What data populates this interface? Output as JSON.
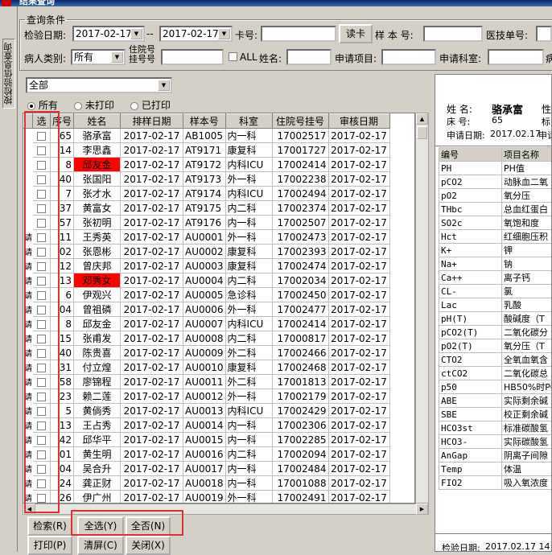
{
  "window": {
    "title": "结果查询"
  },
  "side_tab": {
    "label": "按检验信息查询"
  },
  "query": {
    "legend": "查询条件",
    "date_label": "检验日期:",
    "date_from": "2017-02-17",
    "date_sep": "--",
    "date_to": "2017-02-17",
    "card_label": "卡号:",
    "card_value": "",
    "read_card_label": "读卡",
    "sample_no_label": "样 本 号:",
    "tech_no_label": "医技单号:",
    "patient_type_label": "病人类别:",
    "patient_type_value": "所有",
    "hosp_no_label_1": "住院号",
    "hosp_no_label_2": "挂号号",
    "all_label": "ALL",
    "name_label": "姓名:",
    "req_item_label": "申请项目:",
    "req_dept_label": "申请科室:",
    "cut_label": "病"
  },
  "filter": {
    "combo_value": "全部",
    "radio_all": "所有",
    "radio_unprinted": "未打印",
    "radio_printed": "已打印"
  },
  "grid": {
    "headers": [
      "",
      "选",
      "序号",
      "姓名",
      "排样日期",
      "样本号",
      "科室",
      "住院号挂号",
      "审核日期"
    ],
    "rows": [
      {
        "mark": "",
        "no": "65",
        "name": "骆承富",
        "date": "2017-02-17",
        "sample": "AB1005",
        "dept": "内一科",
        "hosp": "17002517",
        "audit": "2017-02-17",
        "hl": false
      },
      {
        "mark": "",
        "no": "14",
        "name": "李思鑫",
        "date": "2017-02-17",
        "sample": "AT9171",
        "dept": "康复科",
        "hosp": "17001727",
        "audit": "2017-02-17",
        "hl": false
      },
      {
        "mark": "",
        "no": "8",
        "name": "邱友金",
        "date": "2017-02-17",
        "sample": "AT9172",
        "dept": "内科ICU",
        "hosp": "17002414",
        "audit": "2017-02-17",
        "hl": true
      },
      {
        "mark": "",
        "no": "40",
        "name": "张国阳",
        "date": "2017-02-17",
        "sample": "AT9173",
        "dept": "外一科",
        "hosp": "17002238",
        "audit": "2017-02-17",
        "hl": false
      },
      {
        "mark": "",
        "no": "7",
        "name": "张才水",
        "date": "2017-02-17",
        "sample": "AT9174",
        "dept": "内科ICU",
        "hosp": "17002494",
        "audit": "2017-02-17",
        "hl": false
      },
      {
        "mark": "",
        "no": "37",
        "name": "黄富女",
        "date": "2017-02-17",
        "sample": "AT9175",
        "dept": "内二科",
        "hosp": "17002374",
        "audit": "2017-02-17",
        "hl": false
      },
      {
        "mark": "",
        "no": "57",
        "name": "张初明",
        "date": "2017-02-17",
        "sample": "AT9176",
        "dept": "内一科",
        "hosp": "17002507",
        "audit": "2017-02-17",
        "hl": false
      },
      {
        "mark": "请",
        "no": "11",
        "name": "王秀英",
        "date": "2017-02-17",
        "sample": "AU0001",
        "dept": "外一科",
        "hosp": "17002473",
        "audit": "2017-02-17",
        "hl": false
      },
      {
        "mark": "请",
        "no": "02",
        "name": "张恩彬",
        "date": "2017-02-17",
        "sample": "AU0002",
        "dept": "康复科",
        "hosp": "17002393",
        "audit": "2017-02-17",
        "hl": false
      },
      {
        "mark": "请",
        "no": "12",
        "name": "曾庆邦",
        "date": "2017-02-17",
        "sample": "AU0003",
        "dept": "康复科",
        "hosp": "17002474",
        "audit": "2017-02-17",
        "hl": false
      },
      {
        "mark": "请",
        "no": "13",
        "name": "邓秀女",
        "date": "2017-02-17",
        "sample": "AU0004",
        "dept": "内二科",
        "hosp": "17002034",
        "audit": "2017-02-17",
        "hl": true
      },
      {
        "mark": "请",
        "no": "6",
        "name": "伊观兴",
        "date": "2017-02-17",
        "sample": "AU0005",
        "dept": "急诊科",
        "hosp": "17002450",
        "audit": "2017-02-17",
        "hl": false
      },
      {
        "mark": "请",
        "no": "04",
        "name": "曾祖磷",
        "date": "2017-02-17",
        "sample": "AU0006",
        "dept": "外一科",
        "hosp": "17002477",
        "audit": "2017-02-17",
        "hl": false
      },
      {
        "mark": "请",
        "no": "8",
        "name": "邱友金",
        "date": "2017-02-17",
        "sample": "AU0007",
        "dept": "内科ICU",
        "hosp": "17002414",
        "audit": "2017-02-17",
        "hl": false
      },
      {
        "mark": "请",
        "no": "15",
        "name": "张甫发",
        "date": "2017-02-17",
        "sample": "AU0008",
        "dept": "内二科",
        "hosp": "17000817",
        "audit": "2017-02-17",
        "hl": false
      },
      {
        "mark": "请",
        "no": "40",
        "name": "陈贵喜",
        "date": "2017-02-17",
        "sample": "AU0009",
        "dept": "外二科",
        "hosp": "17002466",
        "audit": "2017-02-17",
        "hl": false
      },
      {
        "mark": "请",
        "no": "31",
        "name": "付立煌",
        "date": "2017-02-17",
        "sample": "AU0010",
        "dept": "康复科",
        "hosp": "17002468",
        "audit": "2017-02-17",
        "hl": false
      },
      {
        "mark": "请",
        "no": "58",
        "name": "廖锦程",
        "date": "2017-02-17",
        "sample": "AU0011",
        "dept": "外二科",
        "hosp": "17001813",
        "audit": "2017-02-17",
        "hl": false
      },
      {
        "mark": "请",
        "no": "23",
        "name": "赖二莲",
        "date": "2017-02-17",
        "sample": "AU0012",
        "dept": "外一科",
        "hosp": "17002179",
        "audit": "2017-02-17",
        "hl": false
      },
      {
        "mark": "请",
        "no": "5",
        "name": "黄倘秀",
        "date": "2017-02-17",
        "sample": "AU0013",
        "dept": "内科ICU",
        "hosp": "17002429",
        "audit": "2017-02-17",
        "hl": false
      },
      {
        "mark": "请",
        "no": "13",
        "name": "王占秀",
        "date": "2017-02-17",
        "sample": "AU0014",
        "dept": "内一科",
        "hosp": "17002306",
        "audit": "2017-02-17",
        "hl": false
      },
      {
        "mark": "请",
        "no": "42",
        "name": "邱华平",
        "date": "2017-02-17",
        "sample": "AU0015",
        "dept": "内一科",
        "hosp": "17002285",
        "audit": "2017-02-17",
        "hl": false
      },
      {
        "mark": "请",
        "no": "01",
        "name": "黄生明",
        "date": "2017-02-17",
        "sample": "AU0016",
        "dept": "内二科",
        "hosp": "17002094",
        "audit": "2017-02-17",
        "hl": false
      },
      {
        "mark": "请",
        "no": "04",
        "name": "吴合升",
        "date": "2017-02-17",
        "sample": "AU0017",
        "dept": "内一科",
        "hosp": "17002484",
        "audit": "2017-02-17",
        "hl": false
      },
      {
        "mark": "请",
        "no": "24",
        "name": "龚正财",
        "date": "2017-02-17",
        "sample": "AU0018",
        "dept": "内一科",
        "hosp": "17001088",
        "audit": "2017-02-17",
        "hl": false
      },
      {
        "mark": "请",
        "no": "26",
        "name": "伊广州",
        "date": "2017-02-17",
        "sample": "AU0019",
        "dept": "外一科",
        "hosp": "17002491",
        "audit": "2017-02-17",
        "hl": false
      }
    ]
  },
  "buttons": {
    "search": "检索(R)",
    "select_all": "全选(Y)",
    "select_none": "全否(N)",
    "print": "打印(P)",
    "clear": "清屏(C)",
    "close": "关闭(X)"
  },
  "patient": {
    "name_label": "姓    名:",
    "name": "骆承富",
    "sex_label": "性",
    "bed_label": "床    号:",
    "bed": "65",
    "mark_label": "标",
    "apply_label": "申请日期:",
    "apply_date": "2017.02.17",
    "apply_cut": "申请"
  },
  "result": {
    "headers": [
      "编号",
      "项目名称"
    ],
    "rows": [
      [
        "PH",
        "PH值"
      ],
      [
        "pCO2",
        "动脉血二氧"
      ],
      [
        "pO2",
        "氧分压"
      ],
      [
        "THbc",
        "总血红蛋白"
      ],
      [
        "SO2c",
        "氧饱和度"
      ],
      [
        "Hct",
        "红细胞压积"
      ],
      [
        "K+",
        "钾"
      ],
      [
        "Na+",
        "钠"
      ],
      [
        "Ca++",
        "离子钙"
      ],
      [
        "CL-",
        "氯"
      ],
      [
        "Lac",
        "乳酸"
      ],
      [
        "pH(T)",
        "酸碱度（T"
      ],
      [
        "pCO2(T)",
        "二氧化碳分"
      ],
      [
        "pO2(T)",
        "氧分压（T"
      ],
      [
        "CTO2",
        "全氧血氧含"
      ],
      [
        "ctCO2",
        "二氧化碳总"
      ],
      [
        "p50",
        "HB50%时PO"
      ],
      [
        "ABE",
        "实际剩余碱"
      ],
      [
        "SBE",
        "校正剩余碱"
      ],
      [
        "HCO3st",
        "标准碳酸氢"
      ],
      [
        "HCO3-",
        "实际碳酸氢"
      ],
      [
        "AnGap",
        "阴离子间隙"
      ],
      [
        "Temp",
        "体温"
      ],
      [
        "FIO2",
        "吸入氧浓度"
      ]
    ]
  },
  "footer": {
    "date_label": "检验日期:",
    "date_value": "2017.02.17 14:"
  },
  "colors": {
    "highlight": "#ff0000",
    "annotation": "#e03030"
  }
}
